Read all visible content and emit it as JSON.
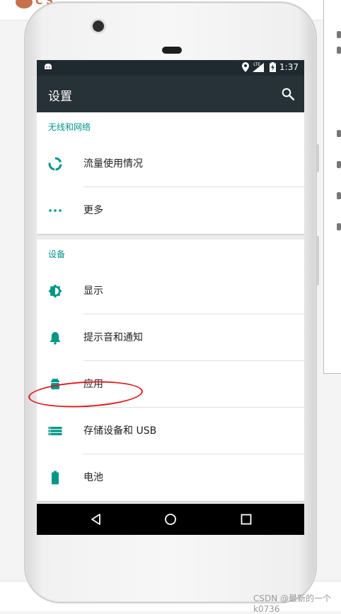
{
  "status_bar": {
    "time": "1:37",
    "network": "LTE"
  },
  "action_bar": {
    "title": "设置"
  },
  "sections": [
    {
      "header": "无线和网络",
      "items": [
        {
          "label": "流量使用情况",
          "icon": "data-usage-icon"
        },
        {
          "label": "更多",
          "icon": "more-horiz-icon"
        }
      ]
    },
    {
      "header": "设备",
      "items": [
        {
          "label": "显示",
          "icon": "brightness-icon"
        },
        {
          "label": "提示音和通知",
          "icon": "bell-icon"
        },
        {
          "label": "应用",
          "icon": "android-icon"
        },
        {
          "label": "存储设备和 USB",
          "icon": "storage-icon"
        },
        {
          "label": "电池",
          "icon": "battery-icon"
        }
      ]
    }
  ],
  "nav_bar": [
    "back-icon",
    "home-icon",
    "recents-icon"
  ],
  "watermark": "CSDN @最新的一个k0736",
  "colors": {
    "accent": "#009688",
    "toolbar": "#263238",
    "statusbar": "#1f2a30",
    "annotation": "#e0191f"
  }
}
